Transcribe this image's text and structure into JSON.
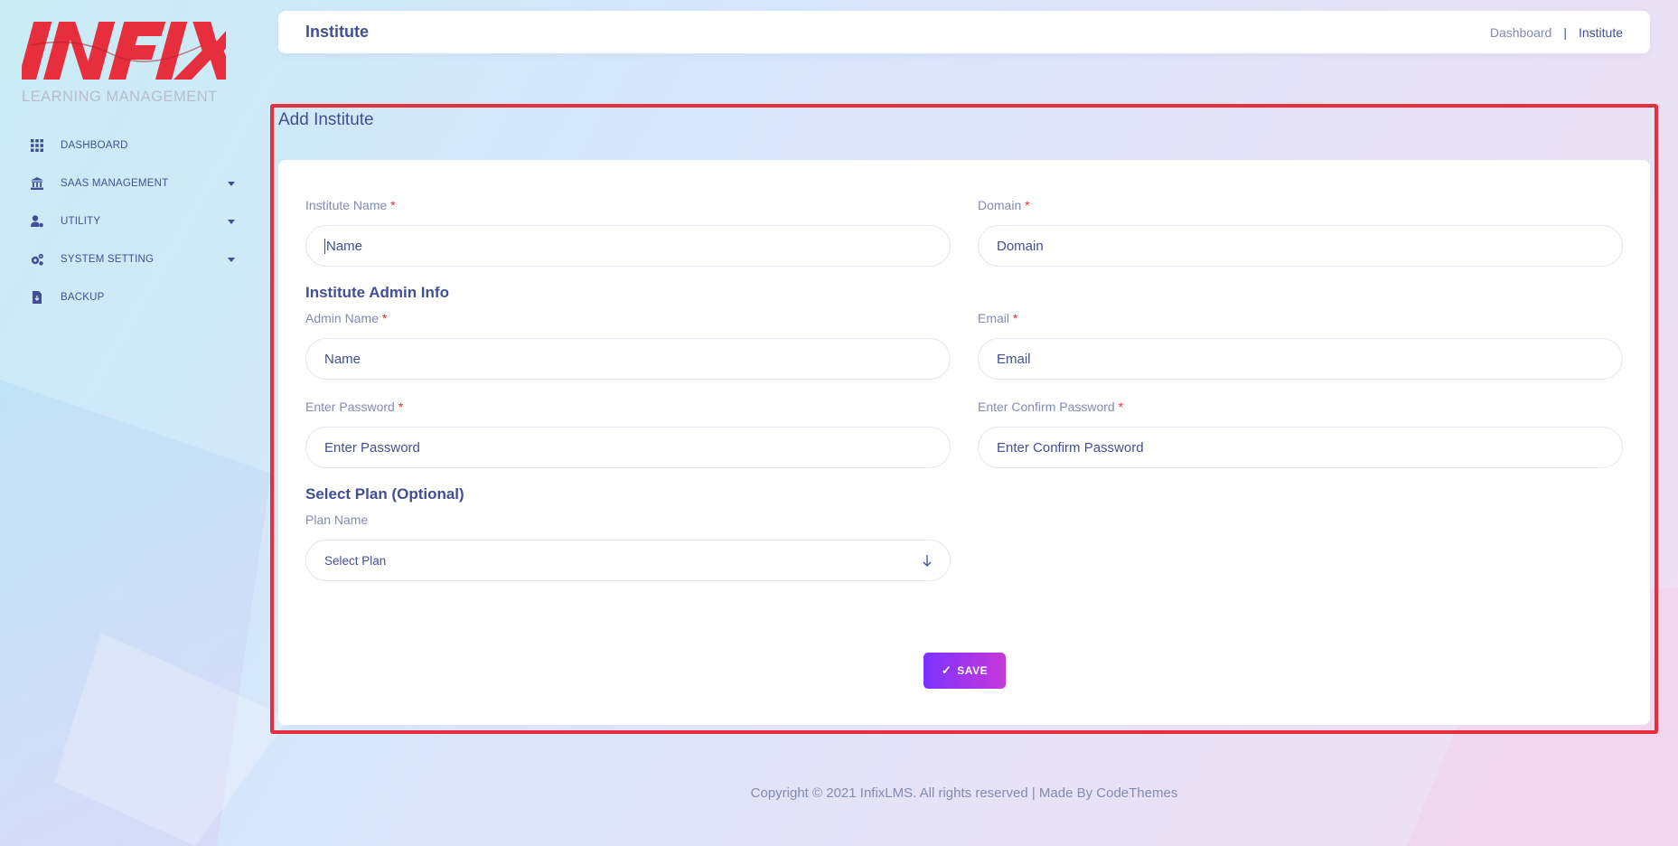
{
  "logo": {
    "wordmark": "INFIX",
    "subtitle": "LEARNING MANAGEMENT",
    "color": "#e62e3c"
  },
  "sidebar": {
    "items": [
      {
        "label": "DASHBOARD",
        "icon": "grid-icon",
        "has_caret": false
      },
      {
        "label": "SAAS MANAGEMENT",
        "icon": "bank-icon",
        "has_caret": true
      },
      {
        "label": "UTILITY",
        "icon": "user-gear-icon",
        "has_caret": true
      },
      {
        "label": "SYSTEM SETTING",
        "icon": "cogs-icon",
        "has_caret": true
      },
      {
        "label": "BACKUP",
        "icon": "file-download-icon",
        "has_caret": false
      }
    ]
  },
  "header": {
    "title": "Institute",
    "breadcrumb": {
      "link": "Dashboard",
      "separator": "|",
      "current": "Institute"
    }
  },
  "form": {
    "section_title": "Add Institute",
    "institute_name": {
      "label": "Institute Name",
      "required": "*",
      "placeholder": "Name"
    },
    "domain": {
      "label": "Domain",
      "required": "*",
      "placeholder": "Domain"
    },
    "admin_info_title": "Institute Admin Info",
    "admin_name": {
      "label": "Admin Name",
      "required": "*",
      "placeholder": "Name"
    },
    "email": {
      "label": "Email",
      "required": "*",
      "placeholder": "Email"
    },
    "password": {
      "label": "Enter Password",
      "required": "*",
      "placeholder": "Enter Password"
    },
    "confirm_password": {
      "label": "Enter Confirm Password",
      "required": "*",
      "placeholder": "Enter Confirm Password"
    },
    "plan_title": "Select Plan (Optional)",
    "plan": {
      "label": "Plan Name",
      "selected": "Select Plan"
    },
    "save_label": "SAVE",
    "save_icon": "✓"
  },
  "footer": {
    "text": "Copyright © 2021 InfixLMS. All rights reserved | Made By CodeThemes"
  },
  "colors": {
    "primary": "#415094",
    "muted": "#828bb2",
    "required": "#e62e3c",
    "highlight_border": "#e62e3c",
    "button_gradient_start": "#7c32ff",
    "button_gradient_end": "#c738d8"
  }
}
